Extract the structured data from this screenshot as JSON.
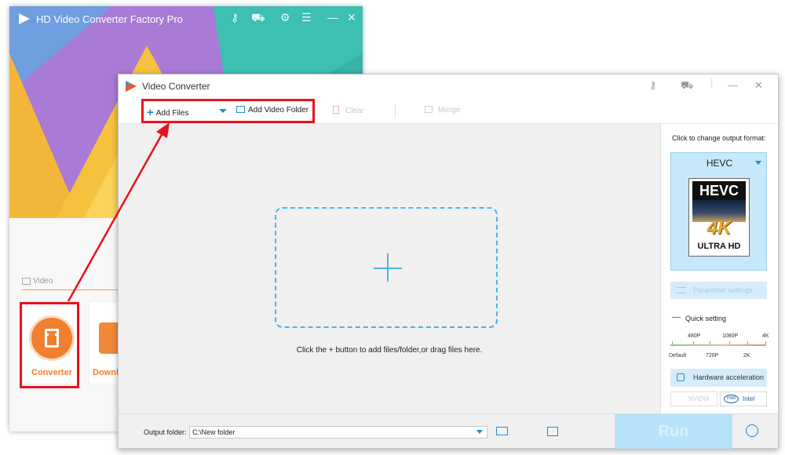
{
  "background_app": {
    "title": "HD Video Converter Factory Pro",
    "section_label": "Video",
    "tiles": [
      {
        "label": "Converter",
        "icon": "film-icon"
      },
      {
        "label": "Downl",
        "icon": "download-icon"
      }
    ]
  },
  "window": {
    "title": "Video Converter"
  },
  "toolbar": {
    "add_files": "Add Files",
    "add_video_folder": "Add Video Folder",
    "clear": "Clear",
    "merge": "Merge"
  },
  "drop_zone": {
    "hint": "Click the + button to add files/folder,or drag files here."
  },
  "right_panel": {
    "format_prompt": "Click to change output format:",
    "format_name": "HEVC",
    "thumb_text": {
      "top": "HEVC",
      "big": "4K",
      "bottom": "ULTRA HD"
    },
    "parameter_settings": "Parameter settings",
    "quick_setting": "Quick setting",
    "quick_levels_top": [
      "480P",
      "1080P",
      "4K"
    ],
    "quick_levels_bottom": [
      "Default",
      "720P",
      "2K"
    ],
    "hardware_acceleration": "Hardware acceleration",
    "gpu_options": [
      "NVIDIA",
      "Intel"
    ],
    "intel_logo_text": "intel"
  },
  "bottom_bar": {
    "output_label": "Output folder:",
    "output_path": "C:\\New folder",
    "run_label": "Run"
  },
  "colors": {
    "accent": "#1e8bd8",
    "highlight": "#e8121e",
    "brand_orange": "#f07f2e"
  }
}
